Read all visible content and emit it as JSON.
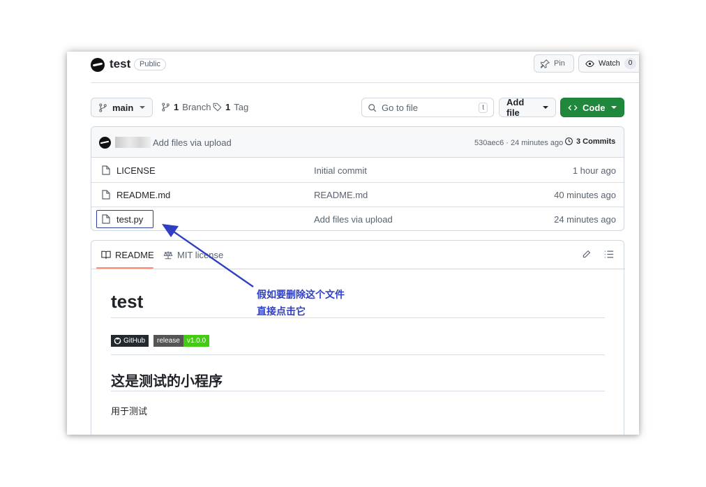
{
  "repo": {
    "name": "test",
    "visibility": "Public"
  },
  "header_actions": {
    "pin_label": "Pin",
    "watch_label": "Watch",
    "watch_count": "0"
  },
  "toolbar": {
    "branch_label": "main",
    "branches_count": "1",
    "branches_label": "Branch",
    "tags_count": "1",
    "tags_label": "Tag",
    "go_to_file_placeholder": "Go to file",
    "go_to_file_shortcut": "t",
    "add_file_label": "Add file",
    "code_label": "Code"
  },
  "latest_commit": {
    "message": "Add files via upload",
    "hash_and_time": "530aec6 · 24 minutes ago",
    "commits_label": "3 Commits"
  },
  "files": [
    {
      "name": "LICENSE",
      "message": "Initial commit",
      "age": "1 hour ago"
    },
    {
      "name": "README.md",
      "message": "README.md",
      "age": "40 minutes ago"
    },
    {
      "name": "test.py",
      "message": "Add files via upload",
      "age": "24 minutes ago"
    }
  ],
  "readme": {
    "tabs": [
      "README",
      "MIT license"
    ],
    "title": "test",
    "badge_github": "GitHub",
    "badge_release_label": "release",
    "badge_release_value": "v1.0.0",
    "heading": "这是测试的小程序",
    "paragraph": "用于测试"
  },
  "annotation": {
    "line1": "假如要删除这个文件",
    "line2": "直接点击它",
    "color": "#2f3fc3"
  },
  "colors": {
    "code_button": "#1f883d",
    "tab_underline": "#fd8c73",
    "release_badge": "#44cc11"
  }
}
